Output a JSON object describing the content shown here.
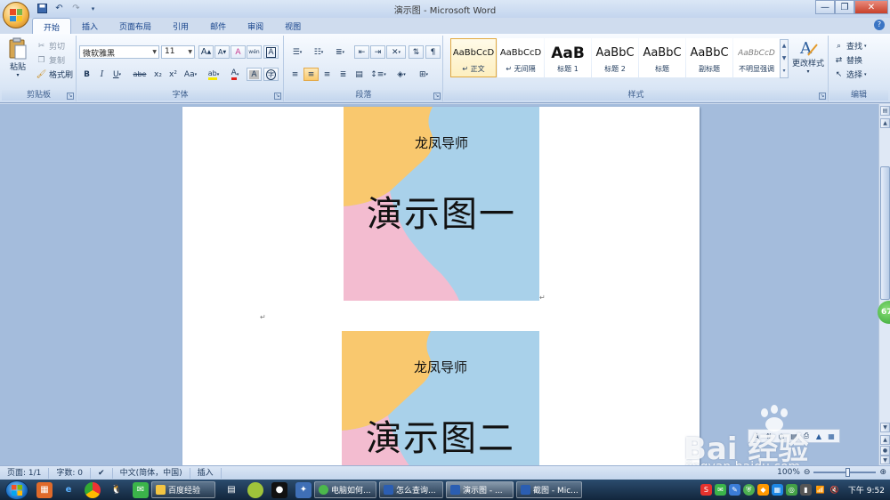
{
  "app": {
    "title": "演示图 - Microsoft Word"
  },
  "tabs": [
    "开始",
    "插入",
    "页面布局",
    "引用",
    "邮件",
    "审阅",
    "视图"
  ],
  "ribbon": {
    "clipboard": {
      "label": "剪贴板",
      "paste": "粘贴",
      "cut": "剪切",
      "copy": "复制",
      "format_painter": "格式刷"
    },
    "font": {
      "label": "字体",
      "font_name": "微软雅黑",
      "font_size": "11",
      "bold": "B",
      "italic": "I",
      "underline": "U",
      "strike": "abe",
      "sub": "x₂",
      "sup": "x²",
      "case": "Aa",
      "grow": "A",
      "shrink": "A",
      "clear": "A",
      "phonetic": "wén",
      "border_char": "A",
      "enclose": "字",
      "highlight": "ab",
      "color": "A"
    },
    "paragraph": {
      "label": "段落"
    },
    "styles": {
      "label": "样式",
      "change_styles": "更改样式",
      "items": [
        {
          "sample": "AaBbCcD",
          "name": "↵ 正文"
        },
        {
          "sample": "AaBbCcD",
          "name": "↵ 无间隔"
        },
        {
          "sample": "AaB",
          "name": "标题 1"
        },
        {
          "sample": "AaBbC",
          "name": "标题 2"
        },
        {
          "sample": "AaBbC",
          "name": "标题"
        },
        {
          "sample": "AaBbC",
          "name": "副标题"
        },
        {
          "sample": "AaBbCcD",
          "name": "不明显强调"
        }
      ]
    },
    "editing": {
      "label": "编辑",
      "find": "查找",
      "replace": "替换",
      "select": "选择"
    }
  },
  "document": {
    "images": [
      {
        "subtitle": "龙凤导师",
        "title": "演示图一"
      },
      {
        "subtitle": "龙凤导师",
        "title": "演示图二"
      }
    ],
    "para_mark": "↵"
  },
  "side_badge": "67",
  "watermark": {
    "brand": "Bai 经验",
    "url": "jingyan.baidu.com"
  },
  "statusbar": {
    "page": "页面: 1/1",
    "words": "字数: 0",
    "language": "中文(简体，中国)",
    "mode": "插入",
    "zoom": "100%"
  },
  "taskbar": {
    "tasks": [
      "百度经验",
      "电脑如何...",
      "怎么查询...",
      "演示图 - ...",
      "截图 - Mic..."
    ],
    "clock": "下午 9:52"
  },
  "colors": {
    "accent": "#1e395b",
    "ribbon": "#dde8f6",
    "workspace": "#a4bcdc",
    "image_orange": "#f9c86e",
    "image_blue": "#a9d1ea",
    "image_pink": "#f3bcd0"
  }
}
